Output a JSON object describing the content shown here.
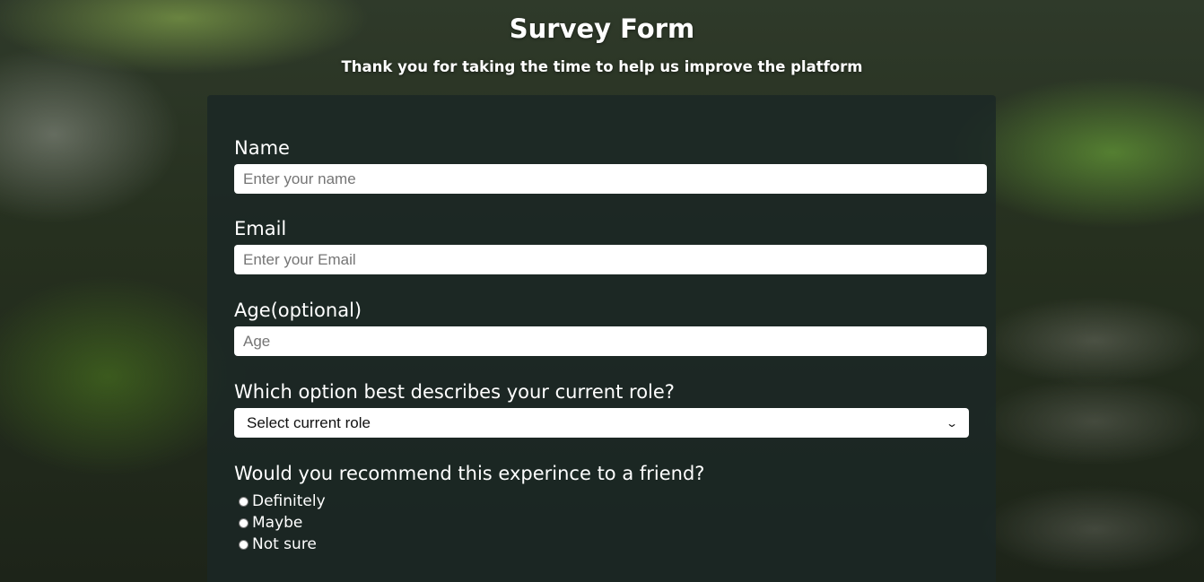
{
  "header": {
    "title": "Survey Form",
    "subtitle": "Thank you for taking the time to help us improve the platform"
  },
  "form": {
    "name": {
      "label": "Name",
      "placeholder": "Enter your name",
      "value": ""
    },
    "email": {
      "label": "Email",
      "placeholder": "Enter your Email",
      "value": ""
    },
    "age": {
      "label": "Age(optional)",
      "placeholder": "Age",
      "value": ""
    },
    "role": {
      "label": "Which option best describes your current role?",
      "selected": "Select current role"
    },
    "recommend": {
      "label": "Would you recommend this experince to a friend?",
      "options": [
        "Definitely",
        "Maybe",
        "Not sure"
      ]
    }
  },
  "colors": {
    "panel": "#1b2726",
    "text": "#ffffff",
    "input_bg": "#ffffff"
  },
  "icons": {
    "select_chevron": "chevron-down-icon"
  }
}
